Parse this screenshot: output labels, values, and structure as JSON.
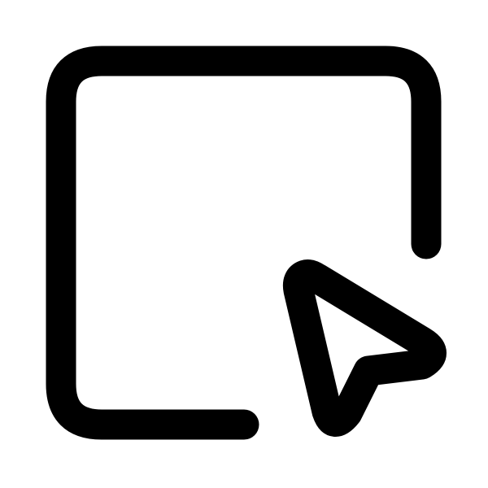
{
  "icon": {
    "name": "select-area-cursor-icon",
    "stroke_color": "#000000",
    "background_color": "#ffffff"
  }
}
